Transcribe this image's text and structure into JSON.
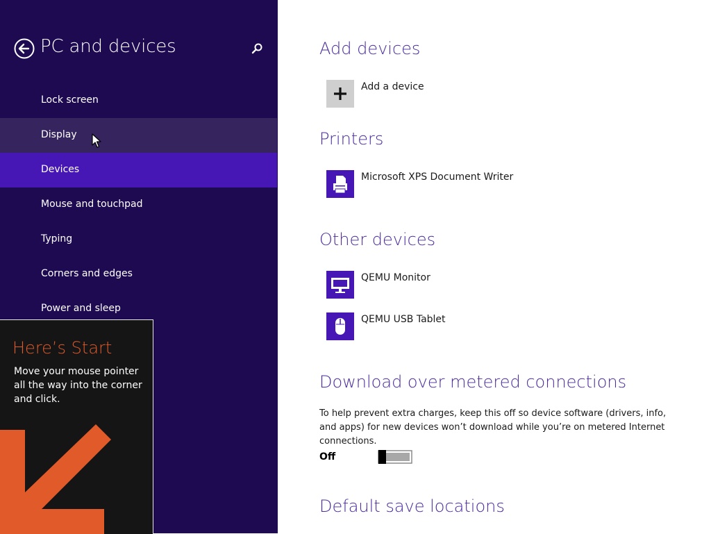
{
  "sidebar": {
    "title": "PC and devices",
    "items": [
      {
        "label": "Lock screen"
      },
      {
        "label": "Display"
      },
      {
        "label": "Devices"
      },
      {
        "label": "Mouse and touchpad"
      },
      {
        "label": "Typing"
      },
      {
        "label": "Corners and edges"
      },
      {
        "label": "Power and sleep"
      }
    ],
    "hovered": "Display",
    "selected": "Devices"
  },
  "start_tip": {
    "title": "Here’s Start",
    "body": "Move your mouse pointer all the way into the corner and click."
  },
  "main": {
    "add_devices": {
      "title": "Add devices",
      "add_label": "Add a device"
    },
    "printers": {
      "title": "Printers",
      "items": [
        {
          "label": "Microsoft XPS Document Writer",
          "icon": "printer-icon"
        }
      ]
    },
    "other_devices": {
      "title": "Other devices",
      "items": [
        {
          "label": "QEMU Monitor",
          "icon": "monitor-icon"
        },
        {
          "label": "QEMU USB Tablet",
          "icon": "mouse-icon"
        }
      ]
    },
    "metered": {
      "title": "Download over metered connections",
      "description": "To help prevent extra charges, keep this off so device software (drivers, info, and apps) for new devices won’t download while you’re on metered Internet connections.",
      "toggle_state": "Off",
      "toggle_on": false
    },
    "save_locations": {
      "title": "Default save locations"
    }
  },
  "colors": {
    "sidebar_bg": "#1e0a51",
    "nav_selected": "#4617b4",
    "nav_hover": "#36245f",
    "accent": "#4a2a9e",
    "tile_bg": "#4617b4",
    "tip_accent": "#e05a2a"
  }
}
